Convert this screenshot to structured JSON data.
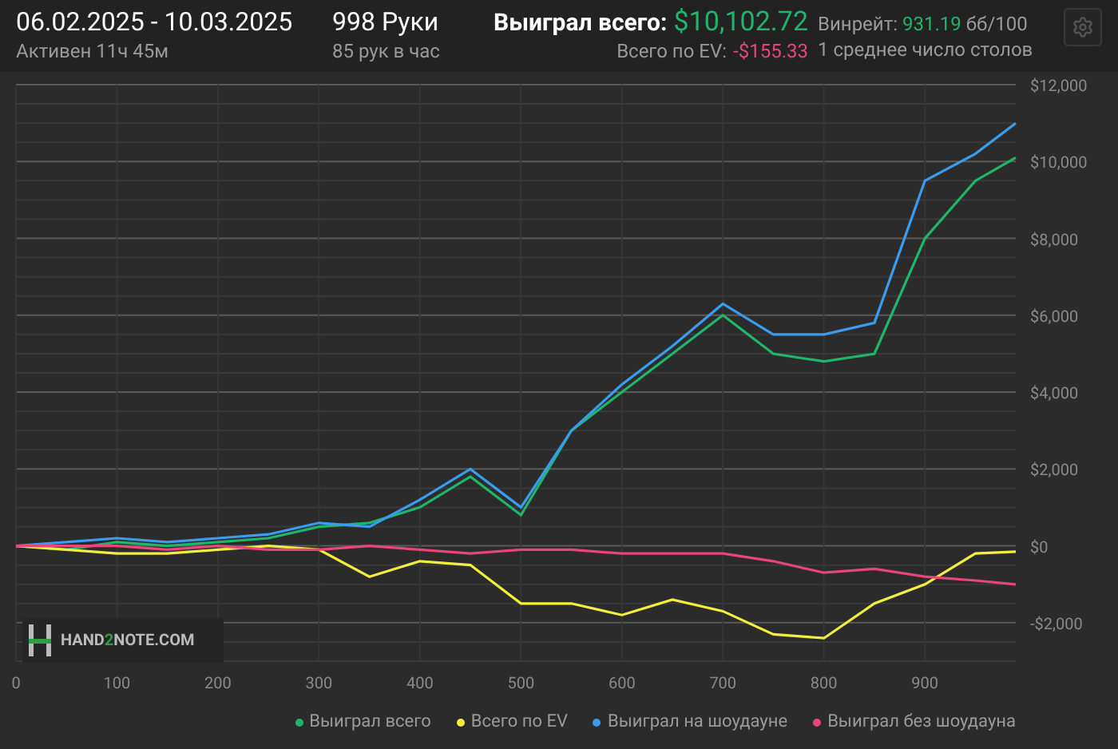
{
  "header": {
    "date_range": "06.02.2025 - 10.03.2025",
    "active_time": "Активен 11ч 45м",
    "hands": "998 Руки",
    "hands_per_hour": "85 рук в час",
    "won_total": {
      "label": "Выиграл всего:",
      "value": "$10,102.72"
    },
    "ev_total": {
      "label": "Всего по EV:",
      "value": "-$155.33"
    },
    "winrate": {
      "label": "Винрейт:",
      "value": "931.19",
      "unit": "бб/100"
    },
    "avg_tables": "1 среднее число столов"
  },
  "chart": {
    "logo": {
      "left": "HAND",
      "mid": "2",
      "right": "NOTE.COM"
    },
    "chart_data": {
      "type": "line",
      "x": [
        0,
        50,
        100,
        150,
        200,
        250,
        300,
        350,
        400,
        450,
        500,
        550,
        600,
        650,
        700,
        750,
        800,
        850,
        900,
        950,
        990
      ],
      "series": [
        {
          "name": "Выиграл всего",
          "color": "#1fb56a",
          "values": [
            0,
            -100,
            100,
            0,
            100,
            200,
            500,
            600,
            1000,
            1800,
            800,
            3000,
            4000,
            5000,
            6000,
            5000,
            4800,
            5000,
            8000,
            9500,
            10100
          ]
        },
        {
          "name": "Всего по EV",
          "color": "#f2ef3c",
          "values": [
            0,
            -100,
            -200,
            -200,
            -100,
            0,
            -100,
            -800,
            -400,
            -500,
            -1500,
            -1500,
            -1800,
            -1400,
            -1700,
            -2300,
            -2400,
            -1500,
            -1000,
            -200,
            -150
          ]
        },
        {
          "name": "Выиграл на шоудауне",
          "color": "#3a9cf0",
          "values": [
            0,
            100,
            200,
            100,
            200,
            300,
            600,
            500,
            1200,
            2000,
            1000,
            3000,
            4200,
            5200,
            6300,
            5500,
            5500,
            5800,
            9500,
            10200,
            11000
          ]
        },
        {
          "name": "Выиграл без шоудауна",
          "color": "#e8457a",
          "values": [
            0,
            0,
            0,
            -100,
            0,
            -100,
            -100,
            0,
            -100,
            -200,
            -100,
            -100,
            -200,
            -200,
            -200,
            -400,
            -700,
            -600,
            -800,
            -900,
            -1000
          ]
        }
      ],
      "grid": true,
      "xlim": [
        0,
        990
      ],
      "ylim": [
        -3000,
        12000
      ],
      "xticks": [
        0,
        100,
        200,
        300,
        400,
        500,
        600,
        700,
        800,
        900
      ],
      "yticks": [
        {
          "value": 12000,
          "label": "$12,000"
        },
        {
          "value": 10000,
          "label": "$10,000"
        },
        {
          "value": 8000,
          "label": "$8,000"
        },
        {
          "value": 6000,
          "label": "$6,000"
        },
        {
          "value": 4000,
          "label": "$4,000"
        },
        {
          "value": 2000,
          "label": "$2,000"
        },
        {
          "value": 0,
          "label": "$0"
        },
        {
          "value": -2000,
          "label": "-$2,000"
        }
      ]
    }
  }
}
